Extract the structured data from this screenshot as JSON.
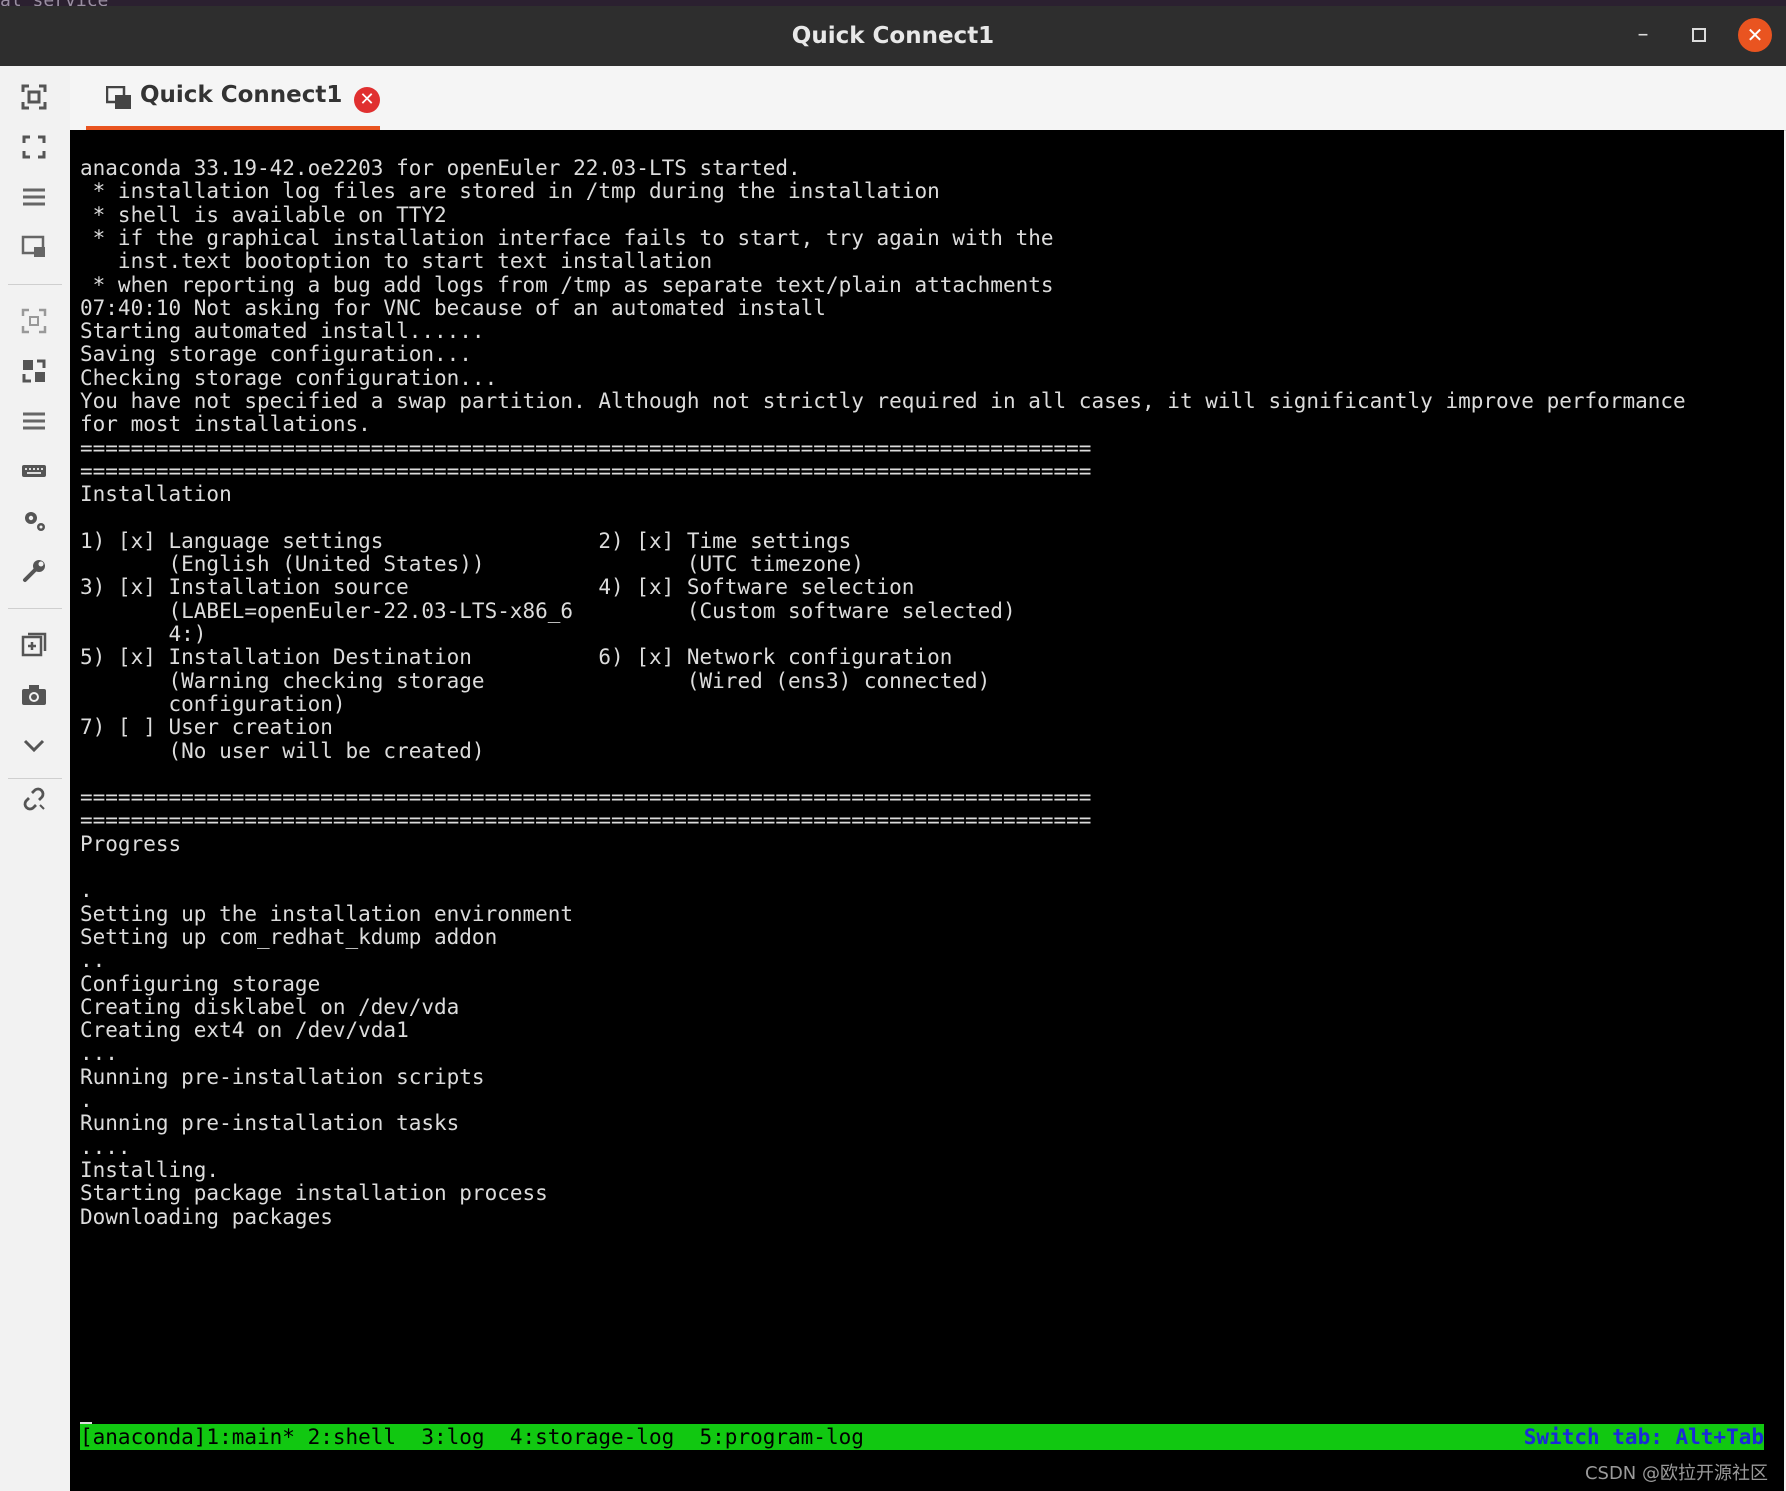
{
  "top_strip_text": "al service",
  "window": {
    "title": "Quick Connect1"
  },
  "tab": {
    "label": "Quick Connect1"
  },
  "terminal": {
    "lines": [
      "anaconda 33.19-42.oe2203 for openEuler 22.03-LTS started.",
      " * installation log files are stored in /tmp during the installation",
      " * shell is available on TTY2",
      " * if the graphical installation interface fails to start, try again with the",
      "   inst.text bootoption to start text installation",
      " * when reporting a bug add logs from /tmp as separate text/plain attachments",
      "07:40:10 Not asking for VNC because of an automated install",
      "Starting automated install......",
      "Saving storage configuration...",
      "Checking storage configuration...",
      "You have not specified a swap partition. Although not strictly required in all cases, it will significantly improve performance",
      "for most installations.",
      "================================================================================",
      "================================================================================",
      "Installation",
      "",
      "1) [x] Language settings                 2) [x] Time settings",
      "       (English (United States))                (UTC timezone)",
      "3) [x] Installation source               4) [x] Software selection",
      "       (LABEL=openEuler-22.03-LTS-x86_6         (Custom software selected)",
      "       4:)",
      "5) [x] Installation Destination          6) [x] Network configuration",
      "       (Warning checking storage                (Wired (ens3) connected)",
      "       configuration)",
      "7) [ ] User creation",
      "       (No user will be created)",
      "",
      "================================================================================",
      "================================================================================",
      "Progress",
      "",
      ".",
      "Setting up the installation environment",
      "Setting up com_redhat_kdump addon",
      "..",
      "Configuring storage",
      "Creating disklabel on /dev/vda",
      "Creating ext4 on /dev/vda1",
      "...",
      "Running pre-installation scripts",
      ".",
      "Running pre-installation tasks",
      "....",
      "Installing.",
      "Starting package installation process",
      "Downloading packages"
    ],
    "status_left": "[anaconda]1:main* 2:shell  3:log  4:storage-log  5:program-log",
    "status_right": "Switch tab: Alt+Tab"
  },
  "sidebar_icons": [
    "screenshot-fit-icon",
    "fullscreen-icon",
    "menu-icon",
    "window-switch-icon",
    "fit-screen-icon",
    "expand-icon",
    "list-icon",
    "keyboard-icon",
    "settings-icon",
    "wrench-icon",
    "new-window-icon",
    "camera-icon",
    "chevron-down-icon",
    "disconnect-icon"
  ],
  "watermark": "CSDN @欧拉开源社区",
  "colors": {
    "accent": "#e95420",
    "status_bar": "#11c811",
    "status_right_text": "#1a2bd8",
    "close_tab": "#e03030"
  }
}
